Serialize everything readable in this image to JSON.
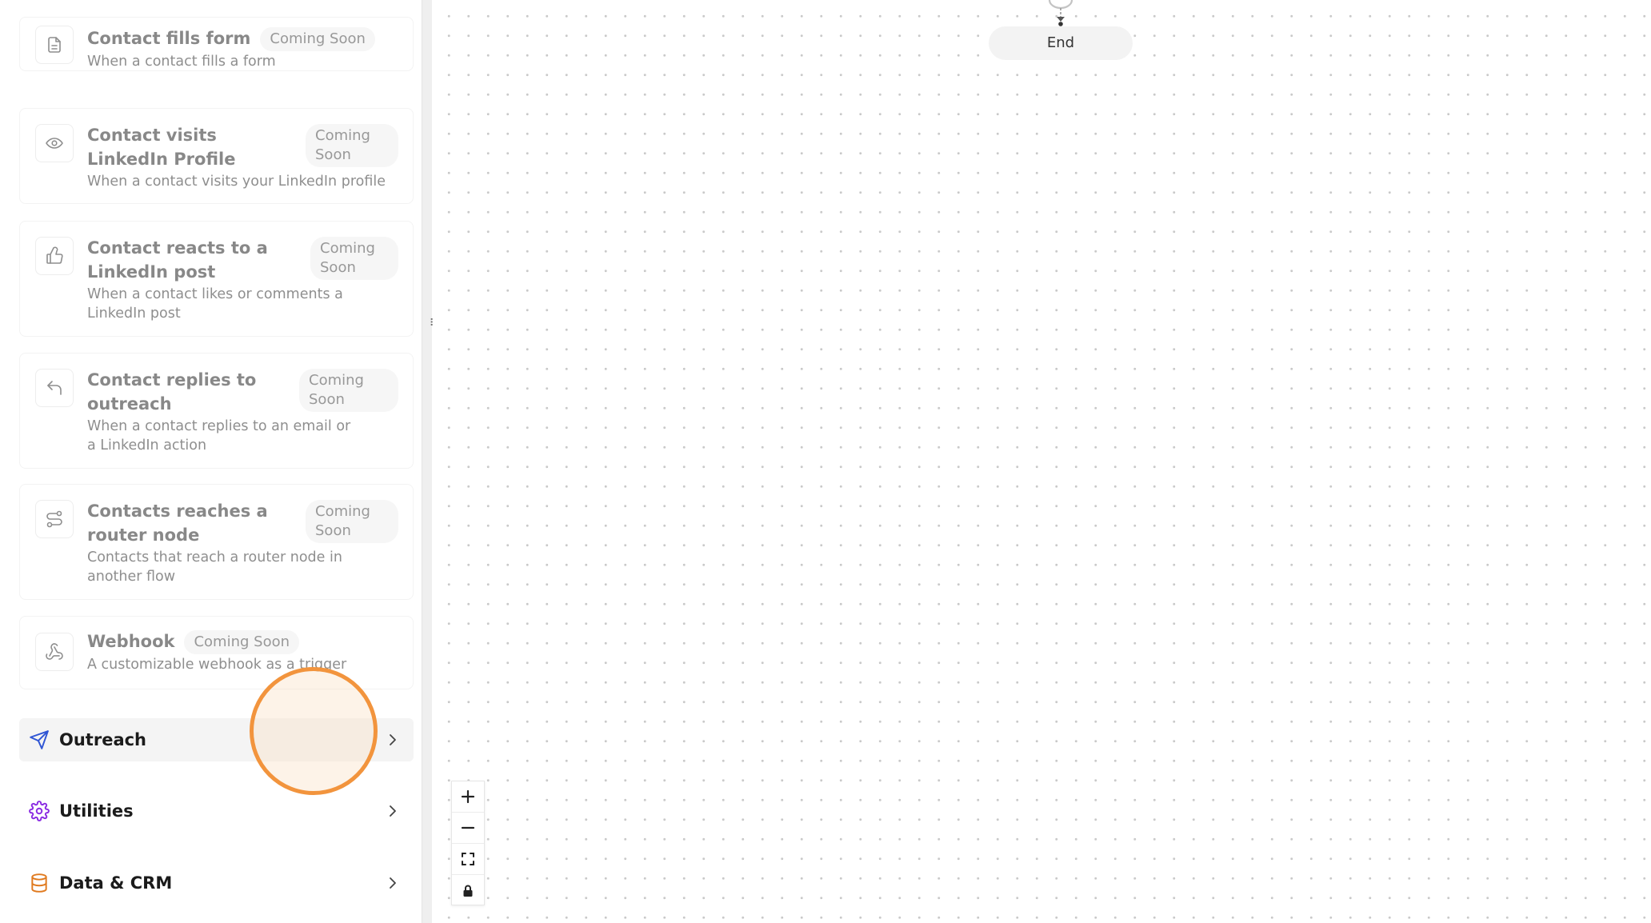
{
  "canvas": {
    "end_node_label": "End"
  },
  "triggers": [
    {
      "id": "form",
      "title": "Contact fills form",
      "badge": "Coming Soon",
      "description": "When a contact fills a form",
      "icon": "document-icon"
    },
    {
      "id": "visit",
      "title": "Contact visits LinkedIn Profile",
      "badge": "Coming Soon",
      "description": "When a contact visits your LinkedIn profile",
      "icon": "eye-icon"
    },
    {
      "id": "react",
      "title": "Contact reacts to a LinkedIn post",
      "badge": "Coming Soon",
      "description": "When a contact likes or comments a LinkedIn post",
      "icon": "thumbs-up-icon"
    },
    {
      "id": "reply",
      "title": "Contact replies to outreach",
      "badge": "Coming Soon",
      "description": "When a contact replies to an email or a LinkedIn action",
      "icon": "reply-icon"
    },
    {
      "id": "router",
      "title": "Contacts reaches a router node",
      "badge": "Coming Soon",
      "description": "Contacts that reach a router node in another flow",
      "icon": "route-icon"
    },
    {
      "id": "webhook",
      "title": "Webhook",
      "badge": "Coming Soon",
      "description": "A customizable webhook as a trigger",
      "icon": "webhook-icon"
    }
  ],
  "categories": [
    {
      "label": "Outreach",
      "icon": "send-icon",
      "color": "#2f55d4"
    },
    {
      "label": "Utilities",
      "icon": "gear-icon",
      "color": "#8a2be2"
    },
    {
      "label": "Data & CRM",
      "icon": "database-icon",
      "color": "#e07a1f"
    }
  ],
  "controls": [
    "zoom-in",
    "zoom-out",
    "fit-view",
    "lock"
  ],
  "colors": {
    "highlight": "#f2943d",
    "outreach": "#2f55d4",
    "utilities": "#8a2be2",
    "data_crm": "#e07a1f"
  }
}
